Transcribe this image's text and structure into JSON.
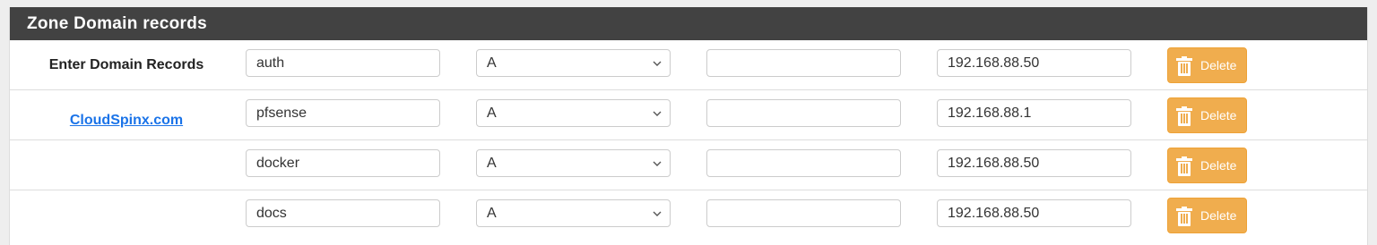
{
  "panel": {
    "title": "Zone Domain records"
  },
  "section_label": "Enter Domain Records",
  "zone_link": "CloudSpinx.com",
  "records": [
    {
      "host": "auth",
      "type": "A",
      "mx": "",
      "address": "192.168.88.50"
    },
    {
      "host": "pfsense",
      "type": "A",
      "mx": "",
      "address": "192.168.88.1"
    },
    {
      "host": "docker",
      "type": "A",
      "mx": "",
      "address": "192.168.88.50"
    },
    {
      "host": "docs",
      "type": "A",
      "mx": "",
      "address": "192.168.88.50"
    }
  ],
  "delete_label": "Delete",
  "icons": {
    "delete": "trash-icon",
    "select": "chevron-down-icon"
  },
  "colors": {
    "header_bg": "#424242",
    "delete_bg": "#f0ad4e",
    "link": "#1a73e8"
  }
}
